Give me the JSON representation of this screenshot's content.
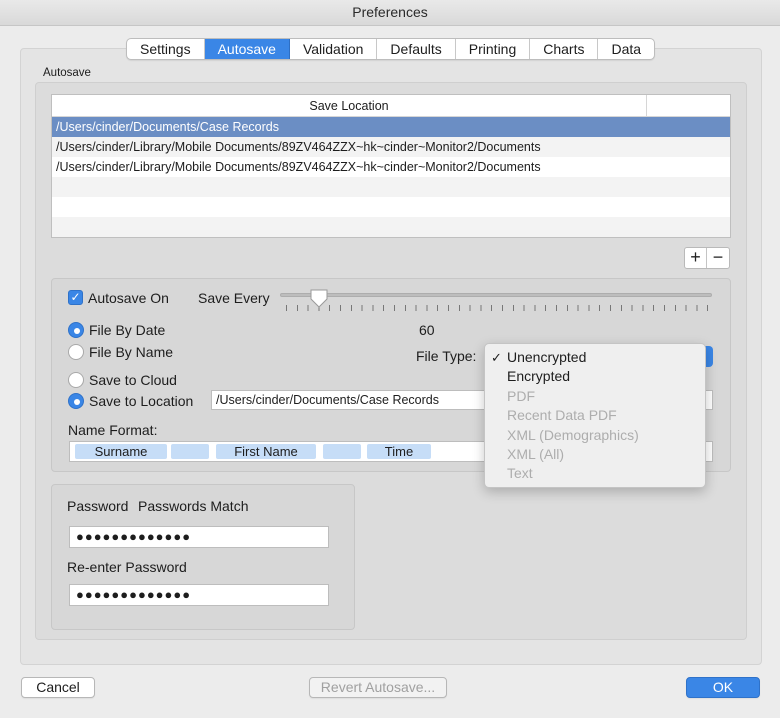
{
  "window": {
    "title": "Preferences"
  },
  "tabs": [
    {
      "label": "Settings",
      "active": false
    },
    {
      "label": "Autosave",
      "active": true
    },
    {
      "label": "Validation",
      "active": false
    },
    {
      "label": "Defaults",
      "active": false
    },
    {
      "label": "Printing",
      "active": false
    },
    {
      "label": "Charts",
      "active": false
    },
    {
      "label": "Data",
      "active": false
    }
  ],
  "autosave": {
    "group_label": "Autosave",
    "table": {
      "column_header": "Save Location",
      "rows": [
        "/Users/cinder/Documents/Case Records",
        "/Users/cinder/Library/Mobile Documents/89ZV464ZZX~hk~cinder~Monitor2/Documents",
        "/Users/cinder/Library/Mobile Documents/89ZV464ZZX~hk~cinder~Monitor2/Documents"
      ],
      "selected_index": 0
    },
    "add_label": "+",
    "remove_label": "−"
  },
  "options": {
    "autosave_on_label": "Autosave On",
    "autosave_on_checked": true,
    "save_every_label": "Save Every",
    "save_every_value": "60",
    "file_by_date_label": "File By Date",
    "file_by_name_label": "File By Name",
    "save_to_cloud_label": "Save to Cloud",
    "save_to_location_label": "Save to Location",
    "location_value": "/Users/cinder/Documents/Case Records",
    "file_type_label": "File Type:",
    "name_format_label": "Name Format:",
    "name_tokens": [
      "Surname",
      "",
      "First Name",
      "",
      "Time"
    ]
  },
  "file_type_menu": {
    "items": [
      {
        "label": "Unencrypted",
        "checked": true,
        "enabled": true
      },
      {
        "label": "Encrypted",
        "checked": false,
        "enabled": true
      },
      {
        "label": "PDF",
        "checked": false,
        "enabled": false
      },
      {
        "label": "Recent Data PDF",
        "checked": false,
        "enabled": false
      },
      {
        "label": "XML (Demographics)",
        "checked": false,
        "enabled": false
      },
      {
        "label": "XML (All)",
        "checked": false,
        "enabled": false
      },
      {
        "label": "Text",
        "checked": false,
        "enabled": false
      }
    ],
    "check_mark": "✓"
  },
  "password": {
    "password_label": "Password",
    "match_status": "Passwords Match",
    "password_value": "●●●●●●●●●●●●●",
    "reenter_label": "Re-enter Password",
    "reenter_value": "●●●●●●●●●●●●●"
  },
  "footer": {
    "cancel_label": "Cancel",
    "revert_label": "Revert Autosave...",
    "ok_label": "OK"
  },
  "colors": {
    "accent": "#3a86e6",
    "selection_row": "#6b8ec4",
    "token_bg": "#c6ddf7",
    "disabled_text": "#adadad"
  }
}
